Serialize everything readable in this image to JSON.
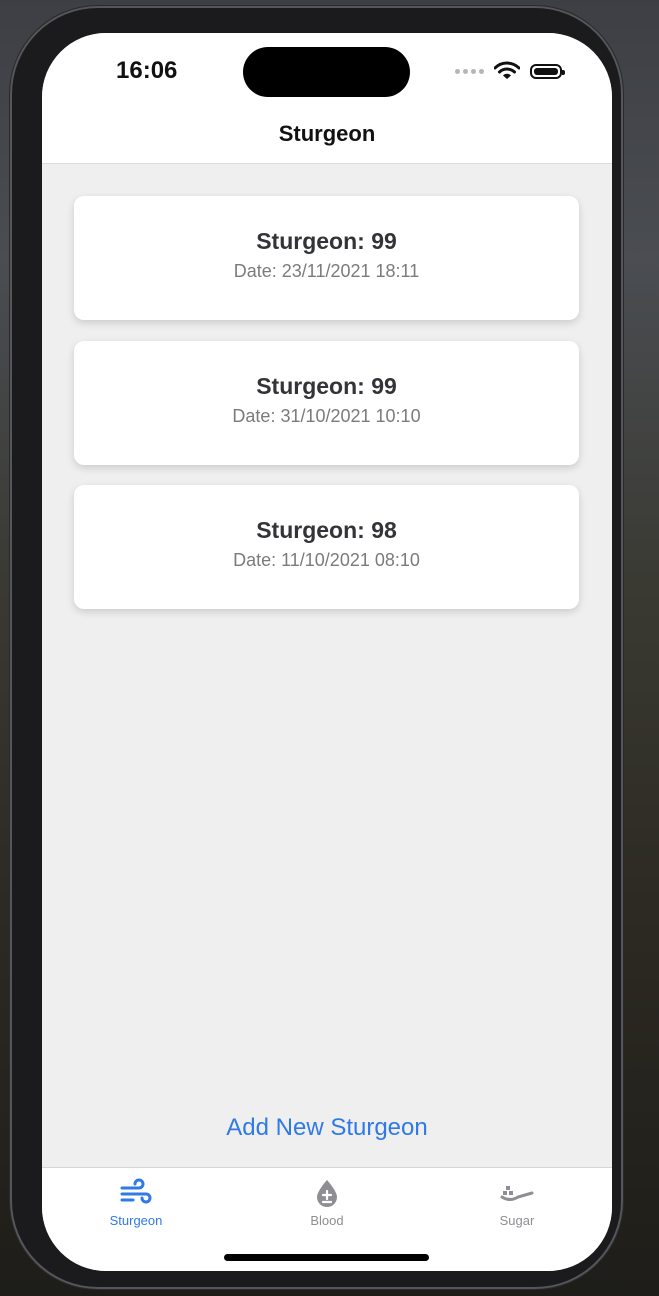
{
  "status_bar": {
    "time": "16:06"
  },
  "nav": {
    "title": "Sturgeon"
  },
  "records": [
    {
      "value": "Sturgeon: 99",
      "date": "Date: 23/11/2021 18:11"
    },
    {
      "value": "Sturgeon: 99",
      "date": "Date: 31/10/2021 10:10"
    },
    {
      "value": "Sturgeon: 98",
      "date": "Date: 11/10/2021 08:10"
    }
  ],
  "add_button": {
    "label": "Add New Sturgeon"
  },
  "tabs": [
    {
      "label": "Sturgeon",
      "icon": "wind-icon",
      "selected": true
    },
    {
      "label": "Blood",
      "icon": "drop-icon",
      "selected": false
    },
    {
      "label": "Sugar",
      "icon": "spoon-icon",
      "selected": false
    }
  ],
  "colors": {
    "accent": "#2f7ae6",
    "inactive": "#8e8e93",
    "background": "#efefef"
  }
}
